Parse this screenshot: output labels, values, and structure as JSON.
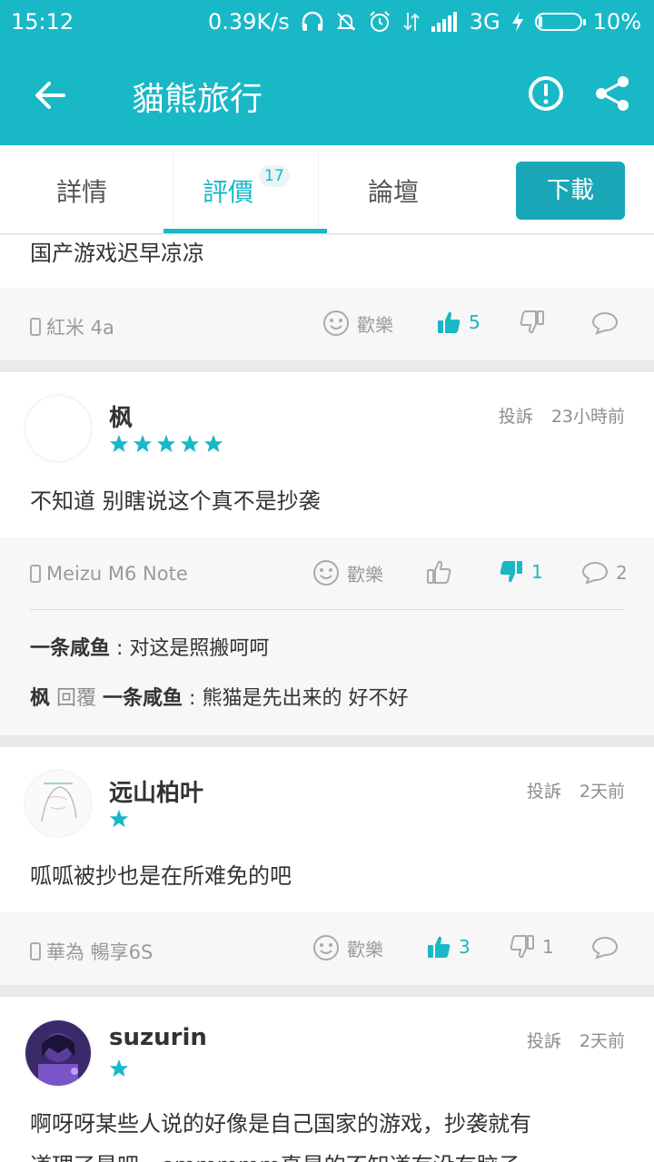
{
  "status_bar": {
    "time": "15:12",
    "network_speed": "0.39K/s",
    "network_type": "3G",
    "battery_percent": "10%",
    "battery_level": 0.1
  },
  "app_bar": {
    "title": "貓熊旅行",
    "back_icon": "arrow-left-icon",
    "report_icon": "exclamation-circle-icon",
    "share_icon": "share-icon"
  },
  "tabs": {
    "details": "詳情",
    "reviews": "評價",
    "reviews_count": "17",
    "forum": "論壇",
    "download": "下載"
  },
  "reviews": [
    {
      "comment": "国产游戏迟早凉凉",
      "device": "紅米 4a",
      "emote_label": "歡樂",
      "likes": "5",
      "liked": true,
      "dislikes": "",
      "replies": ""
    },
    {
      "user": "枫",
      "stars": 5,
      "report": "投訴",
      "time": "23小時前",
      "comment": "不知道 别瞎说这个真不是抄袭",
      "device": "Meizu M6 Note",
      "emote_label": "歡樂",
      "likes": "",
      "dislikes": "1",
      "disliked": true,
      "replies": "2",
      "reply_list": [
        {
          "author": "一条咸鱼",
          "sep": " : ",
          "text": "对这是照搬呵呵"
        },
        {
          "author": "枫",
          "reply_word": "回覆",
          "target": "一条咸鱼",
          "sep": " : ",
          "text": "熊猫是先出来的 好不好"
        }
      ]
    },
    {
      "user": "远山柏叶",
      "stars": 1,
      "report": "投訴",
      "time": "2天前",
      "comment": "呱呱被抄也是在所难免的吧",
      "device": "華為 暢享6S",
      "emote_label": "歡樂",
      "likes": "3",
      "liked": true,
      "dislikes": "1",
      "replies": ""
    },
    {
      "user": "suzurin",
      "stars": 1,
      "report": "投訴",
      "time": "2天前",
      "comment_line1": "啊呀呀某些人说的好像是自己国家的游戏，抄袭就有",
      "comment_line2": "道理了是吧，emmmmm真是的不知道有没有脑子"
    }
  ],
  "colors": {
    "accent": "#19b8c7",
    "download_bg": "#19a7b7",
    "text": "#333333",
    "muted": "#9a9a9a"
  }
}
